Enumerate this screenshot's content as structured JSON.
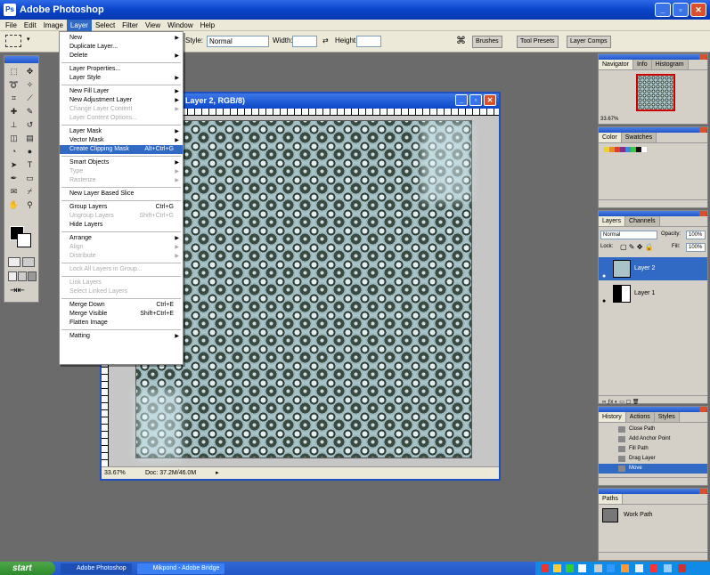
{
  "window": {
    "title": "Adobe Photoshop"
  },
  "menubar": [
    "File",
    "Edit",
    "Image",
    "Layer",
    "Select",
    "Filter",
    "View",
    "Window",
    "Help"
  ],
  "options": {
    "style_label": "Style:",
    "style_value": "Normal",
    "width_label": "Width:",
    "height_label": "Height:",
    "palette_well": [
      "Brushes",
      "Tool Presets",
      "Layer Comps"
    ]
  },
  "document": {
    "title": "Layer 2, RGB/8)",
    "zoom": "33.67%",
    "doc_size": "Doc: 37.2M/46.0M"
  },
  "layer_menu": [
    {
      "label": "New",
      "arrow": true
    },
    {
      "label": "Duplicate Layer..."
    },
    {
      "label": "Delete",
      "arrow": true
    },
    {
      "sep": true
    },
    {
      "label": "Layer Properties..."
    },
    {
      "label": "Layer Style",
      "arrow": true
    },
    {
      "sep": true
    },
    {
      "label": "New Fill Layer",
      "arrow": true
    },
    {
      "label": "New Adjustment Layer",
      "arrow": true
    },
    {
      "label": "Change Layer Content",
      "disabled": true,
      "arrow": true
    },
    {
      "label": "Layer Content Options...",
      "disabled": true
    },
    {
      "sep": true
    },
    {
      "label": "Layer Mask",
      "arrow": true
    },
    {
      "label": "Vector Mask",
      "arrow": true
    },
    {
      "label": "Create Clipping Mask",
      "shortcut": "Alt+Ctrl+G",
      "highlight": true
    },
    {
      "sep": true
    },
    {
      "label": "Smart Objects",
      "arrow": true
    },
    {
      "label": "Type",
      "disabled": true,
      "arrow": true
    },
    {
      "label": "Rasterize",
      "disabled": true,
      "arrow": true
    },
    {
      "sep": true
    },
    {
      "label": "New Layer Based Slice"
    },
    {
      "sep": true
    },
    {
      "label": "Group Layers",
      "shortcut": "Ctrl+G"
    },
    {
      "label": "Ungroup Layers",
      "shortcut": "Shift+Ctrl+G",
      "disabled": true
    },
    {
      "label": "Hide Layers"
    },
    {
      "sep": true
    },
    {
      "label": "Arrange",
      "arrow": true
    },
    {
      "label": "Align",
      "disabled": true,
      "arrow": true
    },
    {
      "label": "Distribute",
      "disabled": true,
      "arrow": true
    },
    {
      "sep": true
    },
    {
      "label": "Lock All Layers in Group...",
      "disabled": true
    },
    {
      "sep": true
    },
    {
      "label": "Link Layers",
      "disabled": true
    },
    {
      "label": "Select Linked Layers",
      "disabled": true
    },
    {
      "sep": true
    },
    {
      "label": "Merge Down",
      "shortcut": "Ctrl+E"
    },
    {
      "label": "Merge Visible",
      "shortcut": "Shift+Ctrl+E"
    },
    {
      "label": "Flatten Image"
    },
    {
      "sep": true
    },
    {
      "label": "Matting",
      "arrow": true
    }
  ],
  "navigator": {
    "tabs": [
      "Navigator",
      "Info",
      "Histogram"
    ],
    "zoom": "33.67%"
  },
  "color": {
    "tabs": [
      "Color",
      "Swatches"
    ]
  },
  "swatch_colors": [
    "#e8d23a",
    "#e88c2a",
    "#d8402a",
    "#8a2a8a",
    "#3a8ad8",
    "#3ac84a",
    "#111111",
    "#ffffff"
  ],
  "layers": {
    "tabs": [
      "Layers",
      "Channels"
    ],
    "blend": "Normal",
    "opacity_label": "Opacity:",
    "opacity": "100%",
    "lock_label": "Lock:",
    "fill_label": "Fill:",
    "fill": "100%",
    "items": [
      {
        "name": "Layer 2",
        "selected": true
      },
      {
        "name": "Layer 1",
        "selected": false
      }
    ]
  },
  "history": {
    "tabs": [
      "History",
      "Actions",
      "Styles"
    ],
    "items": [
      {
        "label": "Close Path"
      },
      {
        "label": "Add Anchor Point"
      },
      {
        "label": "Fill Path"
      },
      {
        "label": "Drag Layer"
      },
      {
        "label": "Move",
        "selected": true
      }
    ]
  },
  "paths": {
    "tabs": [
      "Paths"
    ],
    "items": [
      "Work Path"
    ]
  },
  "taskbar": {
    "start": "start",
    "tasks": [
      "Adobe Photoshop",
      "Mikpond - Adobe Bridge"
    ]
  },
  "colors": {
    "accent": "#316ac5",
    "titlebar": "#0a44c9",
    "workspace": "#6b6b6b"
  }
}
